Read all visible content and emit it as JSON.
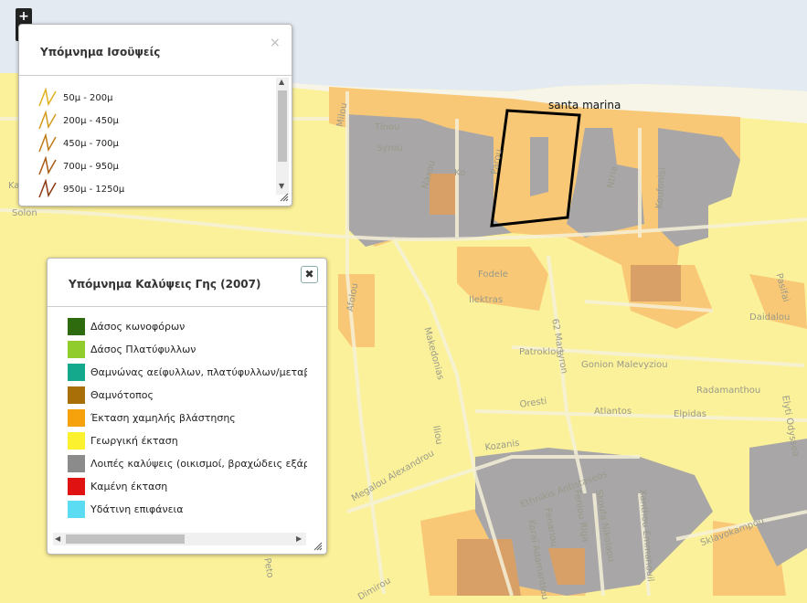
{
  "map": {
    "place_label": "santa marina",
    "streets": [
      {
        "text": "Tinou"
      },
      {
        "text": "Syrou"
      },
      {
        "text": "Milou"
      },
      {
        "text": "Naxou"
      },
      {
        "text": "Ko"
      },
      {
        "text": "Parou"
      },
      {
        "text": "Ntria"
      },
      {
        "text": "Koufonisi"
      },
      {
        "text": "Fodele"
      },
      {
        "text": "Ilektras"
      },
      {
        "text": "Afolou"
      },
      {
        "text": "Makedonias"
      },
      {
        "text": "62 Martyron"
      },
      {
        "text": "Patroklou"
      },
      {
        "text": "Gonion Malevyziou"
      },
      {
        "text": "Oresti"
      },
      {
        "text": "Atlantos"
      },
      {
        "text": "Elpidas"
      },
      {
        "text": "Radamanthou"
      },
      {
        "text": "Daidalou"
      },
      {
        "text": "Pasifai"
      },
      {
        "text": "Elyti Odyssea"
      },
      {
        "text": "Kozanis"
      },
      {
        "text": "Iliou"
      },
      {
        "text": "Megalou Alexandrou"
      },
      {
        "text": "Ethnikis Antistaseos"
      },
      {
        "text": "Fenariou"
      },
      {
        "text": "Feniou Riga"
      },
      {
        "text": "Skoufa Nikolaou"
      },
      {
        "text": "Xanthou Emmanouil"
      },
      {
        "text": "Sklavokampou"
      },
      {
        "text": "Koraï Adamantiou"
      },
      {
        "text": "Solon"
      },
      {
        "text": "Dimirou"
      },
      {
        "text": "Peto"
      },
      {
        "text": "Ka"
      }
    ]
  },
  "zoom": {
    "in_label": "+",
    "out_label": "−"
  },
  "iso_legend": {
    "title": "Υπόμνημα Ισοϋψείς",
    "close_label": "×",
    "items": [
      {
        "label": "50μ - 200μ",
        "color": "#e0b020"
      },
      {
        "label": "200μ - 450μ",
        "color": "#d49a1c"
      },
      {
        "label": "450μ - 700μ",
        "color": "#c07a18"
      },
      {
        "label": "700μ - 950μ",
        "color": "#a85a14"
      },
      {
        "label": "950μ - 1250μ",
        "color": "#8a3a10"
      }
    ]
  },
  "lc_legend": {
    "title": "Υπόμνημα Καλύψεις Γης (2007)",
    "close_label": "✖",
    "items": [
      {
        "label": "Δάσος κωνοφόρων",
        "color": "#2e6b0e"
      },
      {
        "label": "Δάσος Πλατύφυλλων",
        "color": "#8fcc2c"
      },
      {
        "label": "Θαμνώνας αείφυλλων, πλατύφυλλων/μεταβα",
        "color": "#14a88c"
      },
      {
        "label": "Θαμνότοπος",
        "color": "#a86e08"
      },
      {
        "label": "Έκταση χαμηλής βλάστησης",
        "color": "#f6a20c"
      },
      {
        "label": "Γεωργική έκταση",
        "color": "#fbf12e"
      },
      {
        "label": "Λοιπές καλύψεις (οικισμοί, βραχώδεις εξάρσ",
        "color": "#8b8b8b"
      },
      {
        "label": "Καμένη έκταση",
        "color": "#e11212"
      },
      {
        "label": "Υδάτινη επιφάνεια",
        "color": "#5cdcf2"
      }
    ]
  }
}
